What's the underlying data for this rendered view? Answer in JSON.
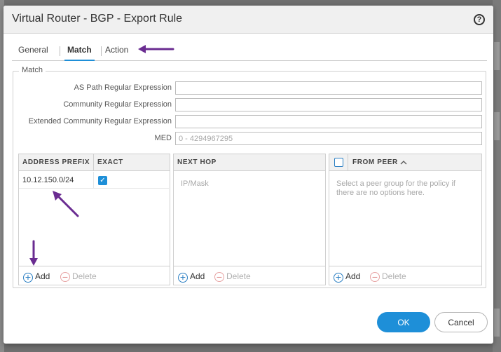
{
  "dialog": {
    "title": "Virtual Router - BGP - Export Rule"
  },
  "tabs": [
    {
      "label": "General"
    },
    {
      "label": "Match",
      "active": true
    },
    {
      "label": "Action"
    }
  ],
  "match": {
    "legend": "Match",
    "fields": [
      {
        "label": "AS Path Regular Expression",
        "value": "",
        "placeholder": ""
      },
      {
        "label": "Community Regular Expression",
        "value": "",
        "placeholder": ""
      },
      {
        "label": "Extended Community Regular Expression",
        "value": "",
        "placeholder": ""
      },
      {
        "label": "MED",
        "value": "",
        "placeholder": "0 - 4294967295"
      }
    ]
  },
  "address_prefix_table": {
    "columns": [
      "ADDRESS PREFIX",
      "EXACT"
    ],
    "rows": [
      {
        "address_prefix": "10.12.150.0/24",
        "exact": true
      }
    ],
    "add_label": "Add",
    "delete_label": "Delete"
  },
  "next_hop_table": {
    "columns": [
      "NEXT HOP"
    ],
    "placeholder": "IP/Mask",
    "add_label": "Add",
    "delete_label": "Delete"
  },
  "from_peer_table": {
    "columns": [
      "FROM PEER"
    ],
    "sort_indicator": "chevron-up-icon",
    "placeholder": "Select a peer group for the policy if there are no options here.",
    "add_label": "Add",
    "delete_label": "Delete"
  },
  "buttons": {
    "ok": "OK",
    "cancel": "Cancel"
  },
  "colors": {
    "accent": "#1e8fd8",
    "annotation_arrow": "#6a2c91"
  }
}
